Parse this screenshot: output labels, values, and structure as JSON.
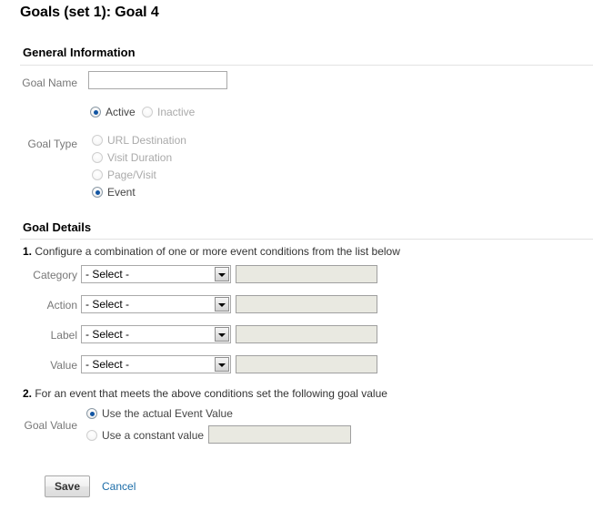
{
  "page": {
    "title": "Goals (set 1): Goal 4"
  },
  "general": {
    "heading": "General Information",
    "goal_name_label": "Goal Name",
    "goal_name_value": "",
    "goal_name_placeholder": "",
    "status": {
      "active_label": "Active",
      "inactive_label": "Inactive",
      "selected": "Active"
    },
    "goal_type_label": "Goal Type",
    "goal_types": [
      {
        "label": "URL Destination",
        "selected": false,
        "disabled": true
      },
      {
        "label": "Visit Duration",
        "selected": false,
        "disabled": true
      },
      {
        "label": "Page/Visit",
        "selected": false,
        "disabled": true
      },
      {
        "label": "Event",
        "selected": true,
        "disabled": false
      }
    ]
  },
  "details": {
    "heading": "Goal Details",
    "step_1_number": "1.",
    "step_1_text": " Configure a combination of one or more event conditions from the list below",
    "conditions": [
      {
        "label": "Category",
        "select_value": "- Select -",
        "text_value": ""
      },
      {
        "label": "Action",
        "select_value": "- Select -",
        "text_value": ""
      },
      {
        "label": "Label",
        "select_value": "- Select -",
        "text_value": ""
      },
      {
        "label": "Value",
        "select_value": "- Select -",
        "text_value": ""
      }
    ],
    "step_2_number": "2.",
    "step_2_text": " For an event that meets the above conditions set the following goal value",
    "goal_value_label": "Goal Value",
    "goal_value_options": [
      {
        "label": "Use the actual Event Value",
        "selected": true
      },
      {
        "label": "Use a constant value",
        "selected": false
      }
    ],
    "constant_value": ""
  },
  "actions": {
    "save_label": "Save",
    "cancel_label": "Cancel"
  },
  "colors": {
    "accent_link": "#1b6ca8",
    "radio_selected": "#1155a3",
    "disabled_field": "#e9e9e1",
    "rule": "#e2e2e2"
  }
}
